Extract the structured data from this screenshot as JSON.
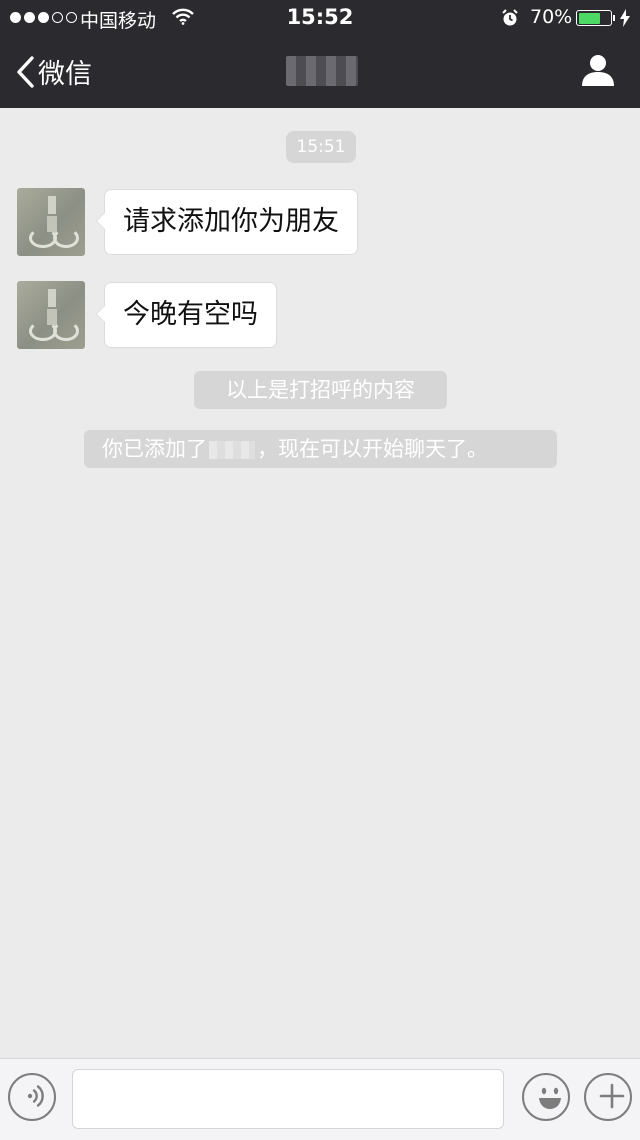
{
  "status_bar": {
    "carrier": "中国移动",
    "time": "15:52",
    "battery_percent": "70%",
    "battery_level": 0.7,
    "signal_bars_filled": 3,
    "signal_bars_total": 5,
    "icons": [
      "wifi-icon",
      "alarm-icon",
      "battery-icon",
      "charging-icon"
    ]
  },
  "nav": {
    "back_label": "微信",
    "title": "",
    "icons": [
      "back-chevron-icon",
      "contact-profile-icon"
    ]
  },
  "chat": {
    "timestamp": "15:51",
    "messages": [
      {
        "sender": "contact",
        "text": "请求添加你为朋友"
      },
      {
        "sender": "contact",
        "text": "今晚有空吗"
      }
    ],
    "system_notices": {
      "greeting_notice": "以上是打招呼的内容",
      "added_prefix": "你已添加了",
      "added_suffix": "，现在可以开始聊天了。"
    }
  },
  "input_bar": {
    "value": "",
    "placeholder": "",
    "icons": [
      "voice-icon",
      "emoji-icon",
      "plus-icon"
    ]
  },
  "colors": {
    "top_bar_bg": "#2b2b2f",
    "chat_bg": "#ebebeb",
    "bubble_bg": "#ffffff",
    "notice_bg": "#d6d6d6",
    "battery_green": "#4cd964"
  }
}
